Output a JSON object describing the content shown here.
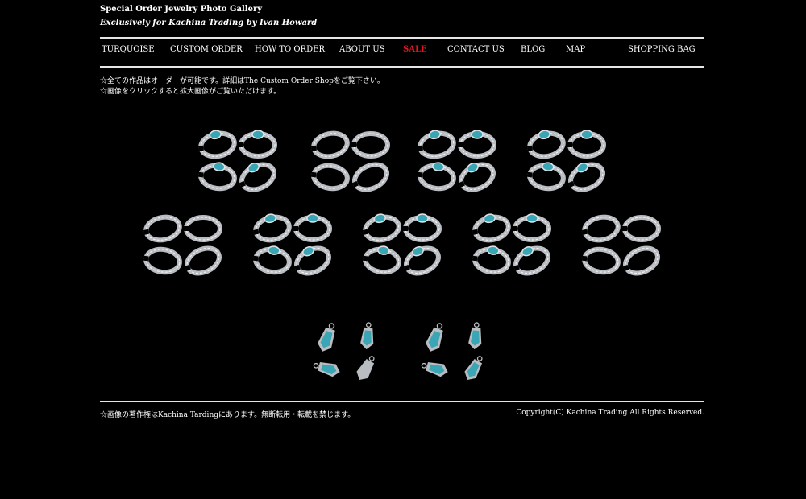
{
  "header": {
    "title": "Special Order Jewelry Photo Gallery",
    "subtitle": "Exclusively for Kachina Trading by Ivan Howard"
  },
  "nav": {
    "items": [
      {
        "label": "TURQUOISE"
      },
      {
        "label": "CUSTOM ORDER"
      },
      {
        "label": "HOW TO ORDER"
      },
      {
        "label": "ABOUT US"
      },
      {
        "label": "SALE"
      },
      {
        "label": "CONTACT US"
      },
      {
        "label": "BLOG"
      },
      {
        "label": "MAP"
      },
      {
        "label": "SHOPPING BAG"
      }
    ],
    "sale_color": "#e8141b"
  },
  "notices": [
    "☆全ての作品はオーダーが可能です。詳細はThe Custom Order Shopをご覧下さい。",
    "☆画像をクリックすると拡大画像がご覧いただけます。"
  ],
  "gallery": {
    "rows": [
      [
        {
          "kind": "bracelet",
          "stone": true
        },
        {
          "kind": "bracelet",
          "stone": false
        },
        {
          "kind": "bracelet",
          "stone": true
        },
        {
          "kind": "bracelet",
          "stone": true
        }
      ],
      [
        {
          "kind": "bracelet",
          "stone": false
        },
        {
          "kind": "bracelet",
          "stone": true
        },
        {
          "kind": "bracelet",
          "stone": true
        },
        {
          "kind": "bracelet",
          "stone": true
        },
        {
          "kind": "bracelet",
          "stone": false
        }
      ],
      [
        {
          "kind": "pendant",
          "stone": true
        },
        {
          "kind": "pendant",
          "stone": true
        }
      ]
    ],
    "silver_color": "#b9bcc0",
    "turquoise_color": "#3aa6b5"
  },
  "footer": {
    "left": "☆画像の著作権はKachina Tardingにあります。無断転用・転載を禁じます。",
    "right": "Copyright(C) Kachina Trading All Rights Reserved."
  }
}
